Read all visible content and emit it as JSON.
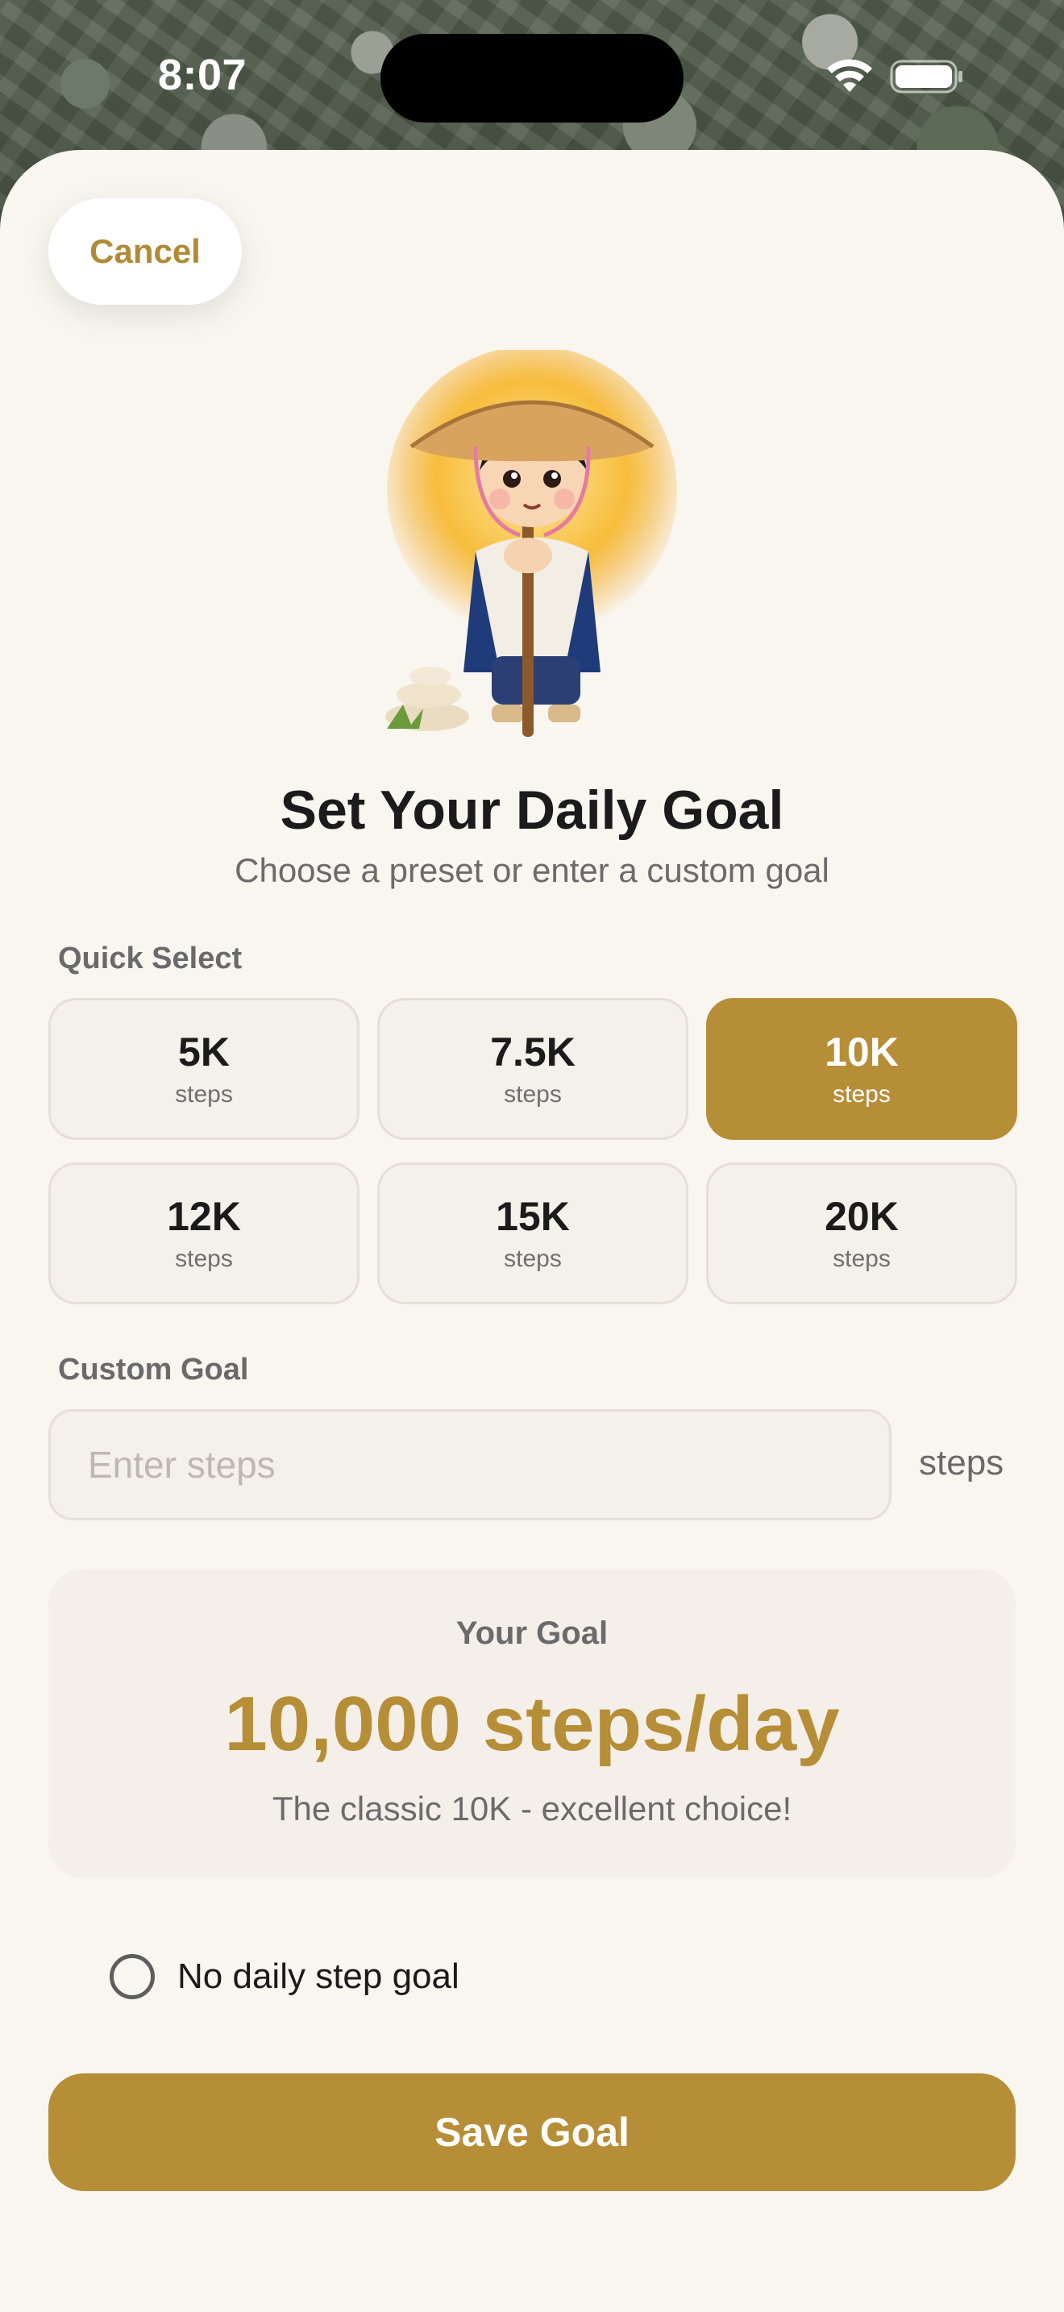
{
  "status_bar": {
    "time": "8:07",
    "icons": [
      "wifi-icon",
      "battery-icon"
    ]
  },
  "header": {
    "cancel_label": "Cancel"
  },
  "hero": {
    "image": "pilgrim-mascot-illustration",
    "title": "Set Your Daily Goal",
    "subtitle": "Choose a preset or enter a custom goal"
  },
  "quick_select": {
    "label": "Quick Select",
    "presets": [
      {
        "value": "5K",
        "unit": "steps",
        "selected": false
      },
      {
        "value": "7.5K",
        "unit": "steps",
        "selected": false
      },
      {
        "value": "10K",
        "unit": "steps",
        "selected": true
      },
      {
        "value": "12K",
        "unit": "steps",
        "selected": false
      },
      {
        "value": "15K",
        "unit": "steps",
        "selected": false
      },
      {
        "value": "20K",
        "unit": "steps",
        "selected": false
      }
    ]
  },
  "custom_goal": {
    "label": "Custom Goal",
    "placeholder": "Enter steps",
    "value": "",
    "unit": "steps"
  },
  "summary": {
    "label": "Your Goal",
    "value": "10,000 steps/day",
    "note": "The classic 10K - excellent choice!"
  },
  "no_goal_option": {
    "label": "No daily step goal",
    "checked": false
  },
  "save_label": "Save Goal",
  "colors": {
    "accent": "#b68e37",
    "background": "#f9f6f0",
    "card": "#f4efe9"
  }
}
